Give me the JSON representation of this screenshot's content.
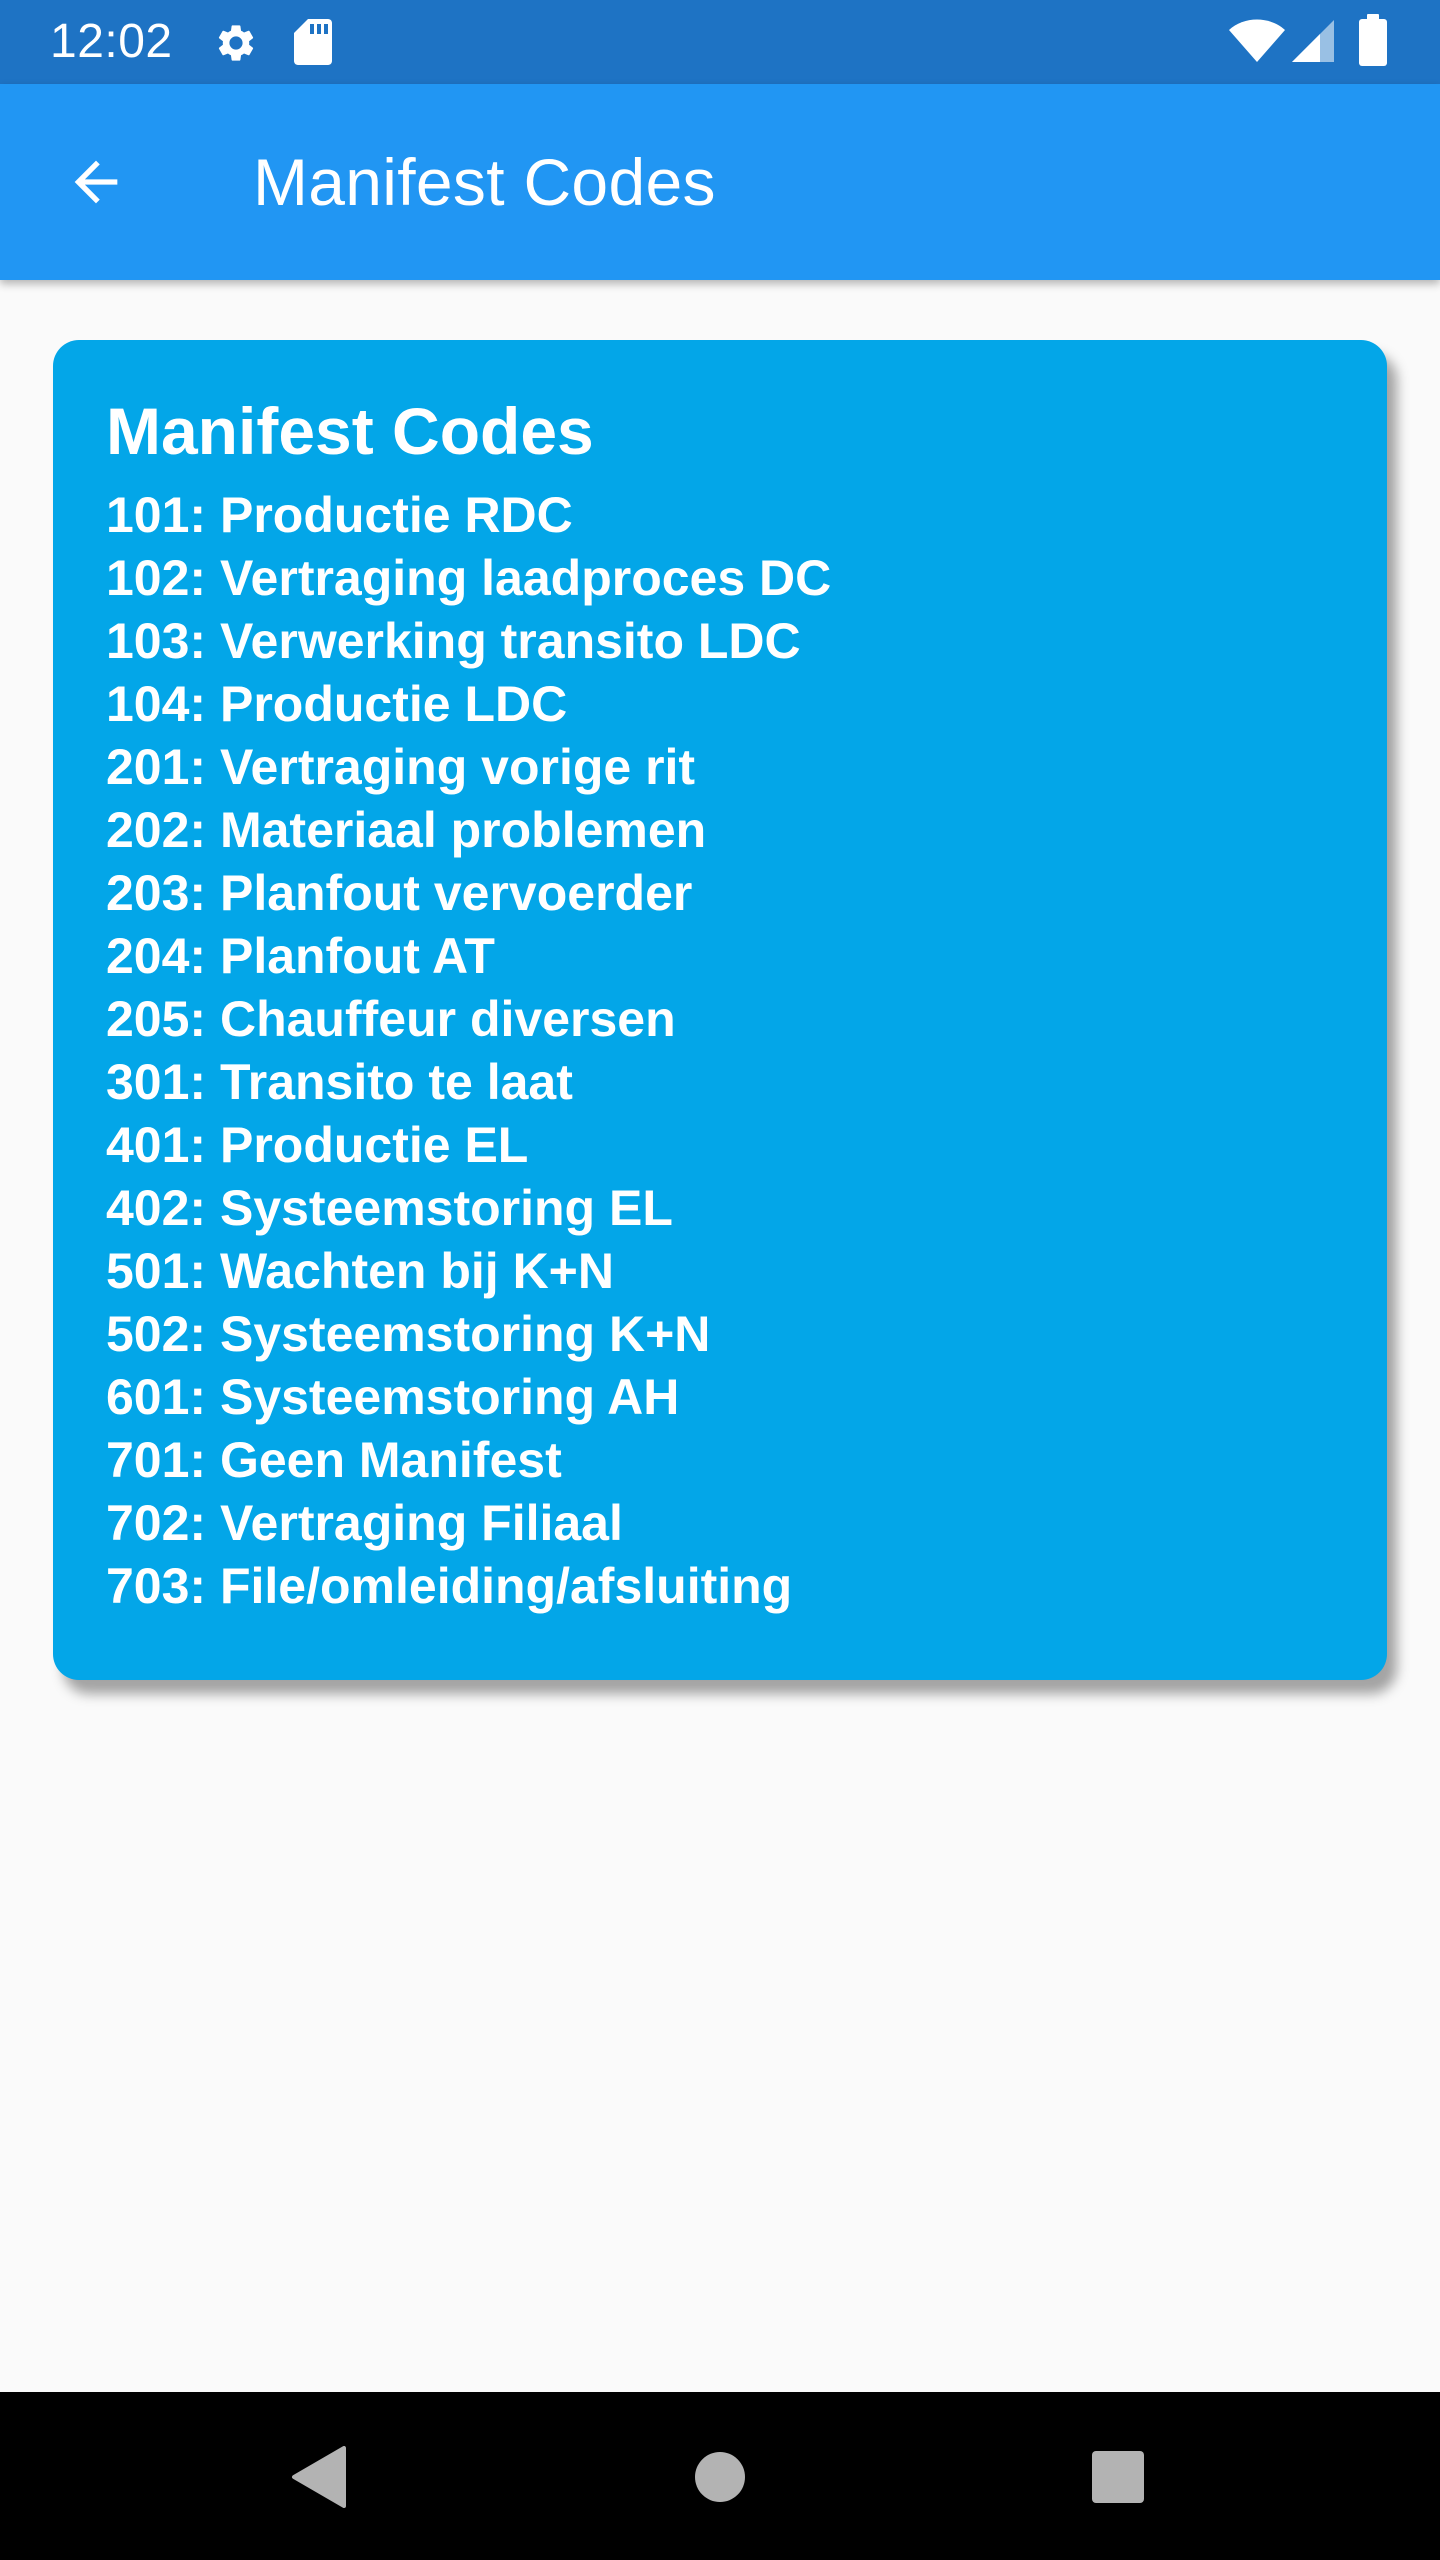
{
  "status_bar": {
    "time": "12:02",
    "icons": [
      "gear-icon",
      "sd-card-icon",
      "wifi-icon",
      "signal-icon",
      "battery-icon"
    ]
  },
  "app_bar": {
    "title": "Manifest Codes",
    "back_icon": "arrow-back-icon",
    "color": "#2196f3"
  },
  "card": {
    "title": "Manifest Codes",
    "color": "#03a6e8",
    "codes": [
      "101: Productie RDC",
      "102: Vertraging laadproces DC",
      "103: Verwerking transito LDC",
      "104: Productie LDC",
      "201: Vertraging vorige rit",
      "202: Materiaal problemen",
      "203: Planfout vervoerder",
      "204: Planfout AT",
      "205: Chauffeur diversen",
      "301: Transito te laat",
      "401: Productie EL",
      "402: Systeemstoring EL",
      "501: Wachten bij K+N",
      "502: Systeemstoring K+N",
      "601: Systeemstoring AH",
      "701: Geen Manifest",
      "702: Vertraging Filiaal",
      "703: File/omleiding/afsluiting"
    ]
  },
  "nav_bar": {
    "icons": [
      "back-triangle-icon",
      "home-circle-icon",
      "recents-square-icon"
    ]
  }
}
